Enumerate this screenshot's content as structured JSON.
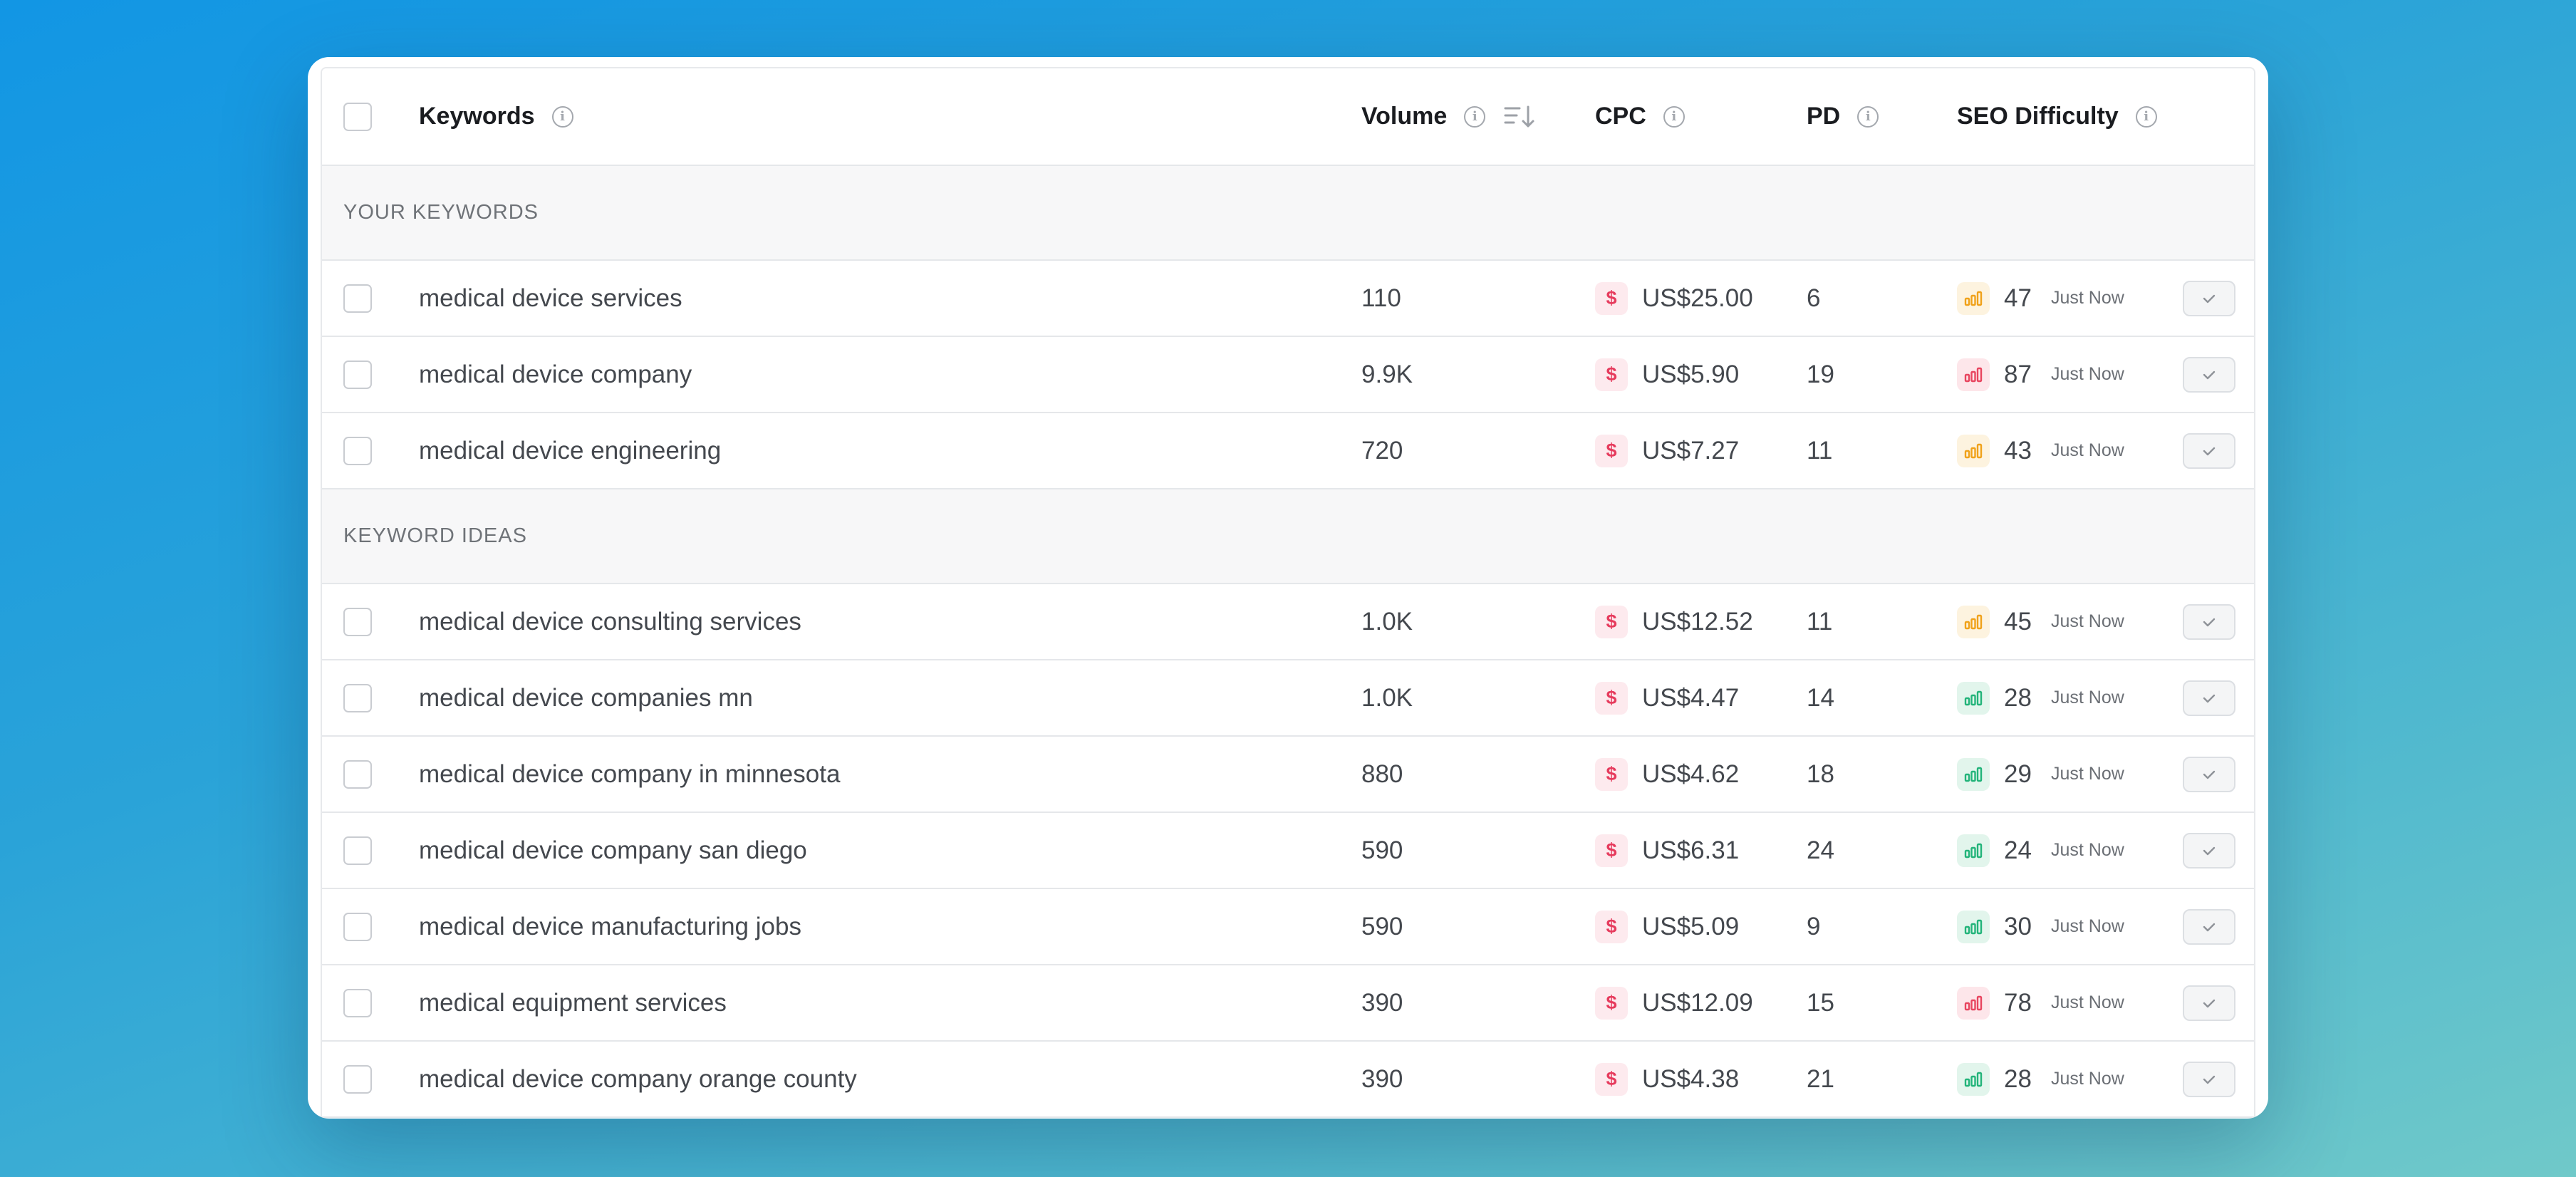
{
  "header": {
    "keywords": "Keywords",
    "volume": "Volume",
    "cpc": "CPC",
    "pd": "PD",
    "seo_difficulty": "SEO Difficulty"
  },
  "sections": {
    "your_keywords": "YOUR KEYWORDS",
    "keyword_ideas": "KEYWORD IDEAS"
  },
  "your_keywords": [
    {
      "keyword": "medical device services",
      "volume": "110",
      "cpc": "US$25.00",
      "pd": "6",
      "seo": "47",
      "level": "orange",
      "time": "Just Now"
    },
    {
      "keyword": "medical device company",
      "volume": "9.9K",
      "cpc": "US$5.90",
      "pd": "19",
      "seo": "87",
      "level": "red",
      "time": "Just Now"
    },
    {
      "keyword": "medical device engineering",
      "volume": "720",
      "cpc": "US$7.27",
      "pd": "11",
      "seo": "43",
      "level": "orange",
      "time": "Just Now"
    }
  ],
  "keyword_ideas": [
    {
      "keyword": "medical device consulting services",
      "volume": "1.0K",
      "cpc": "US$12.52",
      "pd": "11",
      "seo": "45",
      "level": "orange",
      "time": "Just Now"
    },
    {
      "keyword": "medical device companies mn",
      "volume": "1.0K",
      "cpc": "US$4.47",
      "pd": "14",
      "seo": "28",
      "level": "green",
      "time": "Just Now"
    },
    {
      "keyword": "medical device company in minnesota",
      "volume": "880",
      "cpc": "US$4.62",
      "pd": "18",
      "seo": "29",
      "level": "green",
      "time": "Just Now"
    },
    {
      "keyword": "medical device company san diego",
      "volume": "590",
      "cpc": "US$6.31",
      "pd": "24",
      "seo": "24",
      "level": "green",
      "time": "Just Now"
    },
    {
      "keyword": "medical device manufacturing jobs",
      "volume": "590",
      "cpc": "US$5.09",
      "pd": "9",
      "seo": "30",
      "level": "green",
      "time": "Just Now"
    },
    {
      "keyword": "medical equipment services",
      "volume": "390",
      "cpc": "US$12.09",
      "pd": "15",
      "seo": "78",
      "level": "red",
      "time": "Just Now"
    },
    {
      "keyword": "medical device company orange county",
      "volume": "390",
      "cpc": "US$4.38",
      "pd": "21",
      "seo": "28",
      "level": "green",
      "time": "Just Now"
    }
  ],
  "icons": {
    "info": "info-icon",
    "sort": "sort-descending-icon",
    "cpc": "dollar-icon",
    "difficulty": "bar-chart-icon",
    "action": "check-icon"
  },
  "colors": {
    "orange": "#f0a21a",
    "red": "#e8455f",
    "green": "#23b47a",
    "dollar": "#e63b5d"
  }
}
